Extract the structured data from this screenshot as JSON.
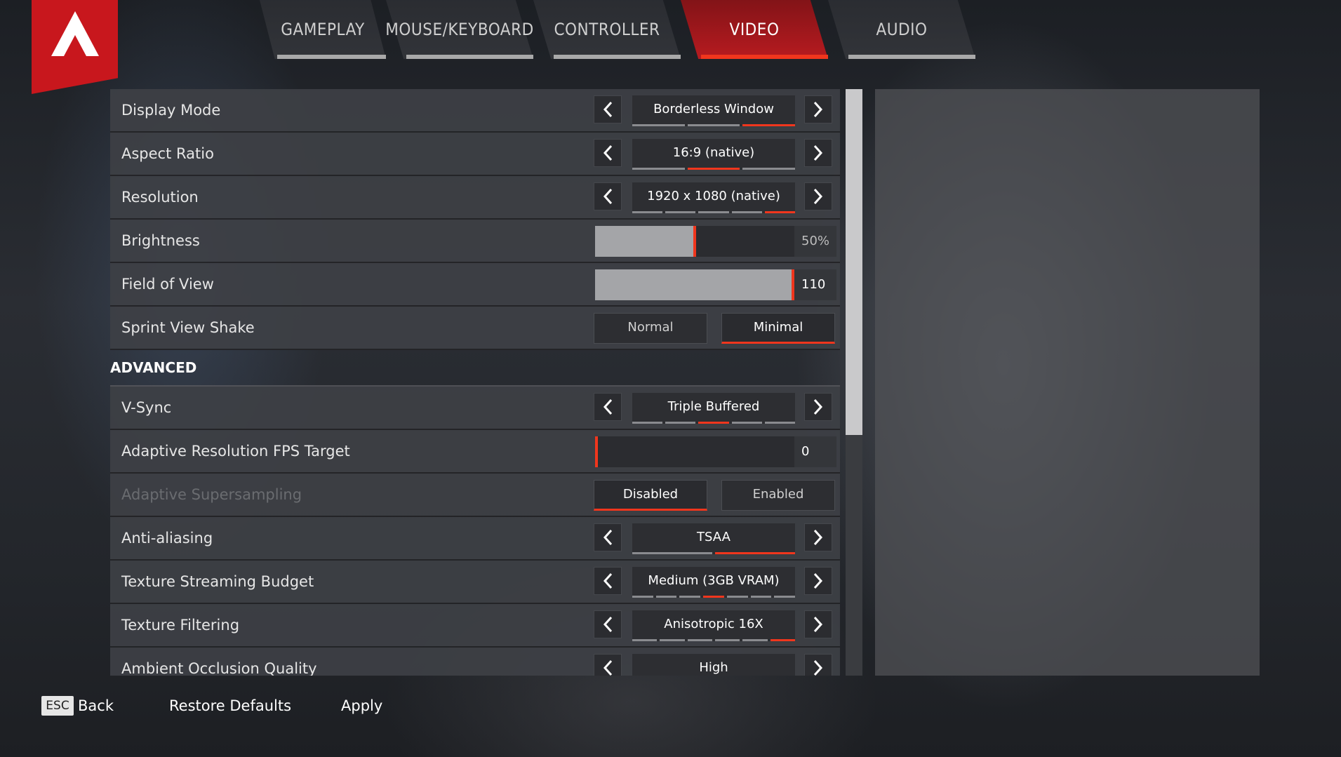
{
  "tabs": [
    {
      "label": "GAMEPLAY",
      "active": false
    },
    {
      "label": "MOUSE/KEYBOARD",
      "active": false
    },
    {
      "label": "CONTROLLER",
      "active": false
    },
    {
      "label": "VIDEO",
      "active": true
    },
    {
      "label": "AUDIO",
      "active": false
    }
  ],
  "settings": {
    "display_mode": {
      "label": "Display Mode",
      "value": "Borderless Window",
      "options_count": 3,
      "selected_index": 2
    },
    "aspect_ratio": {
      "label": "Aspect Ratio",
      "value": "16:9 (native)",
      "options_count": 3,
      "selected_index": 1
    },
    "resolution": {
      "label": "Resolution",
      "value": "1920 x 1080 (native)",
      "options_count": 5,
      "selected_index": 4
    },
    "brightness": {
      "label": "Brightness",
      "value_text": "50%",
      "fraction": 0.5
    },
    "fov": {
      "label": "Field of View",
      "value_text": "110",
      "fraction": 1.0
    },
    "sprint_shake": {
      "label": "Sprint View Shake",
      "option_a": "Normal",
      "option_b": "Minimal",
      "selected": "b"
    },
    "advanced_header": "ADVANCED",
    "vsync": {
      "label": "V-Sync",
      "value": "Triple Buffered",
      "options_count": 5,
      "selected_index": 2
    },
    "adaptive_fps": {
      "label": "Adaptive Resolution FPS Target",
      "value_text": "0",
      "fraction": 0.0
    },
    "adaptive_ss": {
      "label": "Adaptive Supersampling",
      "option_a": "Disabled",
      "option_b": "Enabled",
      "selected": "a",
      "disabled": true
    },
    "anti_aliasing": {
      "label": "Anti-aliasing",
      "value": "TSAA",
      "options_count": 2,
      "selected_index": 1
    },
    "texture_budget": {
      "label": "Texture Streaming Budget",
      "value": "Medium (3GB VRAM)",
      "options_count": 7,
      "selected_index": 3
    },
    "texture_filtering": {
      "label": "Texture Filtering",
      "value": "Anisotropic 16X",
      "options_count": 6,
      "selected_index": 5
    },
    "ambient_occlusion": {
      "label": "Ambient Occlusion Quality",
      "value": "High",
      "options_count": 4,
      "selected_index": 3
    }
  },
  "footer": {
    "esc_key": "ESC",
    "back": "Back",
    "restore": "Restore Defaults",
    "apply": "Apply"
  },
  "colors": {
    "accent": "#f0361d",
    "brand_red": "#c8171d"
  },
  "scrollbar": {
    "visible_fraction": 0.59,
    "position": 0.0
  }
}
